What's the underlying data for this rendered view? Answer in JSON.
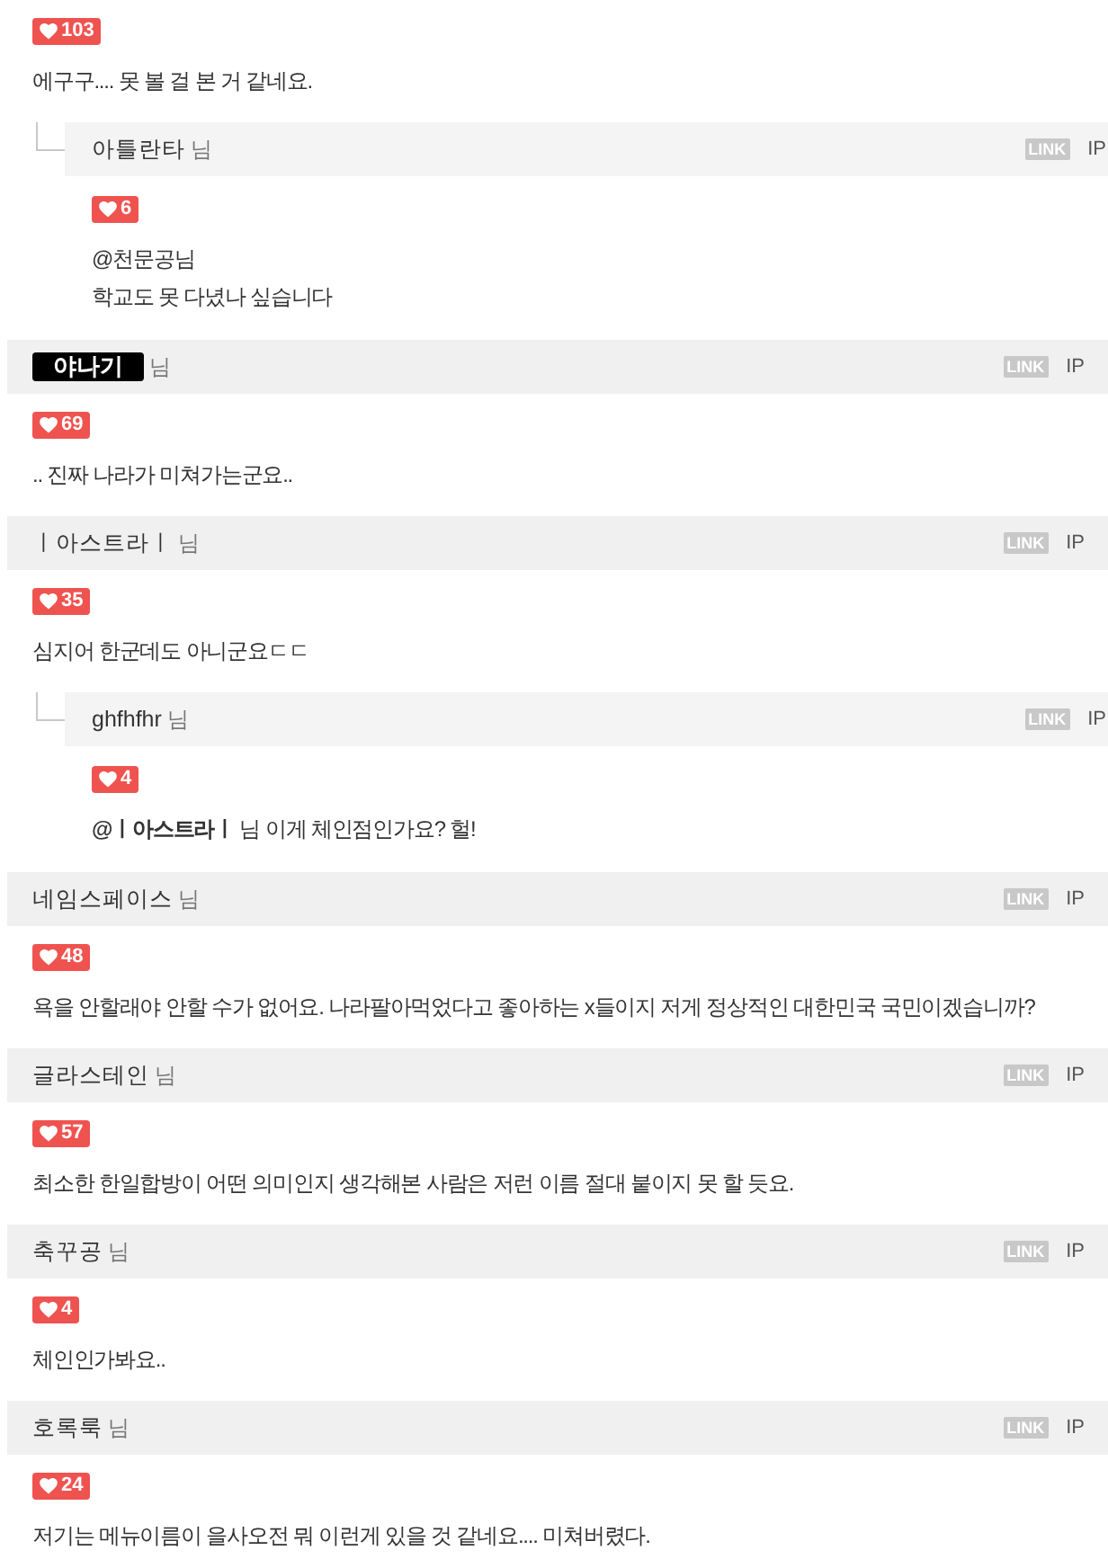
{
  "comments": [
    {
      "likes": "103",
      "lines": [
        "에구구.... 못 볼 걸 본 거 같네요."
      ],
      "replies": [
        {
          "author": {
            "name": "아틀란타",
            "kind": "text",
            "suffix": "님",
            "link": "LINK",
            "ip": "IP"
          },
          "likes": "6",
          "lines": [
            "@천문공님",
            "학교도 못 다녔나 싶습니다"
          ]
        }
      ]
    },
    {
      "author": {
        "name": "야나기",
        "kind": "image",
        "suffix": "님",
        "link": "LINK",
        "ip": "IP"
      },
      "likes": "69",
      "lines": [
        ".. 진짜 나라가 미쳐가는군요.."
      ]
    },
    {
      "author": {
        "name": "ㅣ아스트라ㅣ",
        "kind": "text",
        "suffix": "님",
        "link": "LINK",
        "ip": "IP"
      },
      "likes": "35",
      "lines": [
        "심지어 한군데도 아니군요ㄷㄷ"
      ],
      "replies": [
        {
          "author": {
            "name": "ghfhfhr",
            "kind": "text",
            "suffix": "님",
            "link": "LINK",
            "ip": "IP"
          },
          "likes": "4",
          "lines": [
            "**@ㅣ아스트라ㅣ** 님 이게 체인점인가요? 헐!"
          ]
        }
      ]
    },
    {
      "author": {
        "name": "네임스페이스",
        "kind": "text",
        "suffix": "님",
        "link": "LINK",
        "ip": "IP"
      },
      "likes": "48",
      "lines": [
        "욕을 안할래야 안할 수가 없어요. 나라팔아먹었다고 좋아하는 x들이지 저게 정상적인 대한민국 국민이겠습니까?"
      ]
    },
    {
      "author": {
        "name": "글라스테인",
        "kind": "text",
        "suffix": "님",
        "link": "LINK",
        "ip": "IP"
      },
      "likes": "57",
      "lines": [
        "최소한 한일합방이 어떤 의미인지 생각해본 사람은 저런 이름 절대 붙이지 못 할 듯요."
      ]
    },
    {
      "author": {
        "name": "축꾸공",
        "kind": "text",
        "suffix": "님",
        "link": "LINK",
        "ip": "IP"
      },
      "likes": "4",
      "lines": [
        "체인인가봐요.."
      ]
    },
    {
      "author": {
        "name": "호록룩",
        "kind": "text",
        "suffix": "님",
        "link": "LINK",
        "ip": "IP"
      },
      "likes": "24",
      "lines": [
        "저기는 메뉴이름이 을사오전 뭐 이런게 있을 것 같네요.... 미쳐버렸다."
      ]
    }
  ]
}
